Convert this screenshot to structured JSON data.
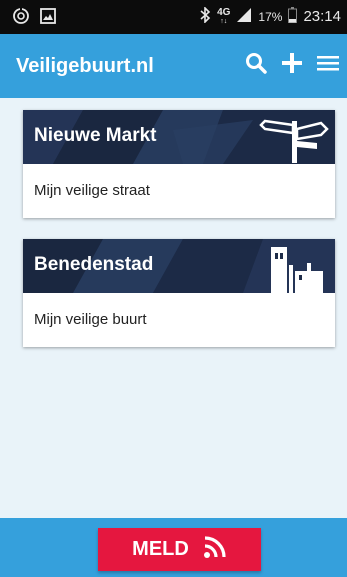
{
  "status_bar": {
    "network": "4G",
    "network_sub": "↑↓",
    "battery": "17%",
    "time": "23:14",
    "icons": [
      "sync-icon",
      "image-icon",
      "bluetooth-icon",
      "signal-icon",
      "battery-icon"
    ]
  },
  "app_bar": {
    "title": "Veiligebuurt.nl",
    "actions": [
      "search-icon",
      "plus-icon",
      "menu-icon"
    ]
  },
  "cards": [
    {
      "title": "Nieuwe Markt",
      "subtitle": "Mijn veilige straat",
      "illustration": "signpost-icon"
    },
    {
      "title": "Benedenstad",
      "subtitle": "Mijn veilige buurt",
      "illustration": "buildings-icon"
    }
  ],
  "bottom": {
    "button_label": "MELD",
    "button_icon": "rss-icon"
  },
  "colors": {
    "primary": "#35a0dc",
    "accent": "#e5173f",
    "card_header": "#1e2c48",
    "status_bar": "#0c0c0c"
  }
}
